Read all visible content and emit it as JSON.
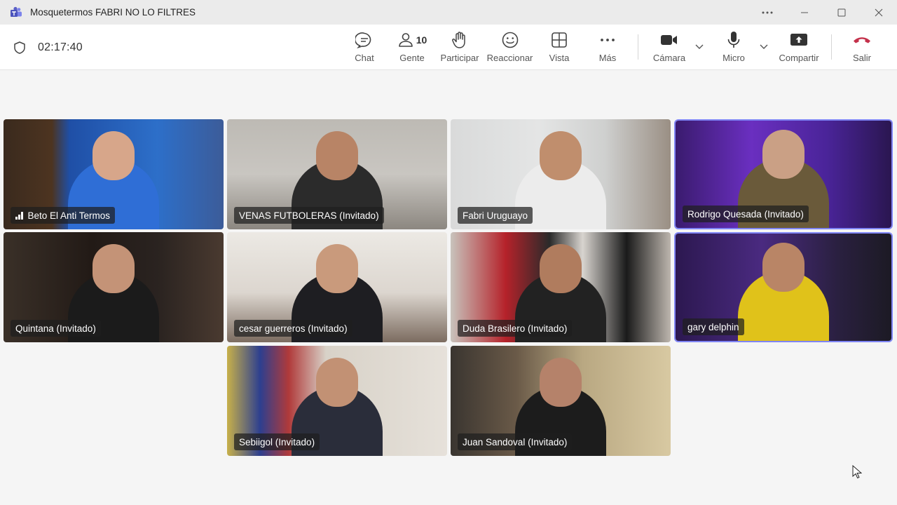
{
  "window": {
    "title": "Mosquetermos FABRI NO LO FILTRES",
    "app_icon": "teams-icon"
  },
  "meeting": {
    "timer": "02:17:40"
  },
  "toolbar": {
    "chat_label": "Chat",
    "people_label": "Gente",
    "people_count": "10",
    "raise_label": "Participar",
    "react_label": "Reaccionar",
    "view_label": "Vista",
    "more_label": "Más",
    "camera_label": "Cámara",
    "mic_label": "Micro",
    "share_label": "Compartir",
    "leave_label": "Salir"
  },
  "colors": {
    "accent": "#7f85f5",
    "leave": "#c4314b",
    "teams": "#5b5fc7"
  },
  "participants": [
    {
      "name": "Beto El Anti Termos",
      "signal_icon": true
    },
    {
      "name": "VENAS FUTBOLERAS (Invitado)"
    },
    {
      "name": "Fabri Uruguayo"
    },
    {
      "name": "Rodrigo Quesada (Invitado)",
      "active": true
    },
    {
      "name": "Quintana (Invitado)"
    },
    {
      "name": "cesar guerreros (Invitado)"
    },
    {
      "name": "Duda Brasilero (Invitado)"
    },
    {
      "name": "gary delphin",
      "active": true
    },
    {
      "name": "Sebiigol (Invitado)"
    },
    {
      "name": "Juan Sandoval (Invitado)"
    }
  ]
}
